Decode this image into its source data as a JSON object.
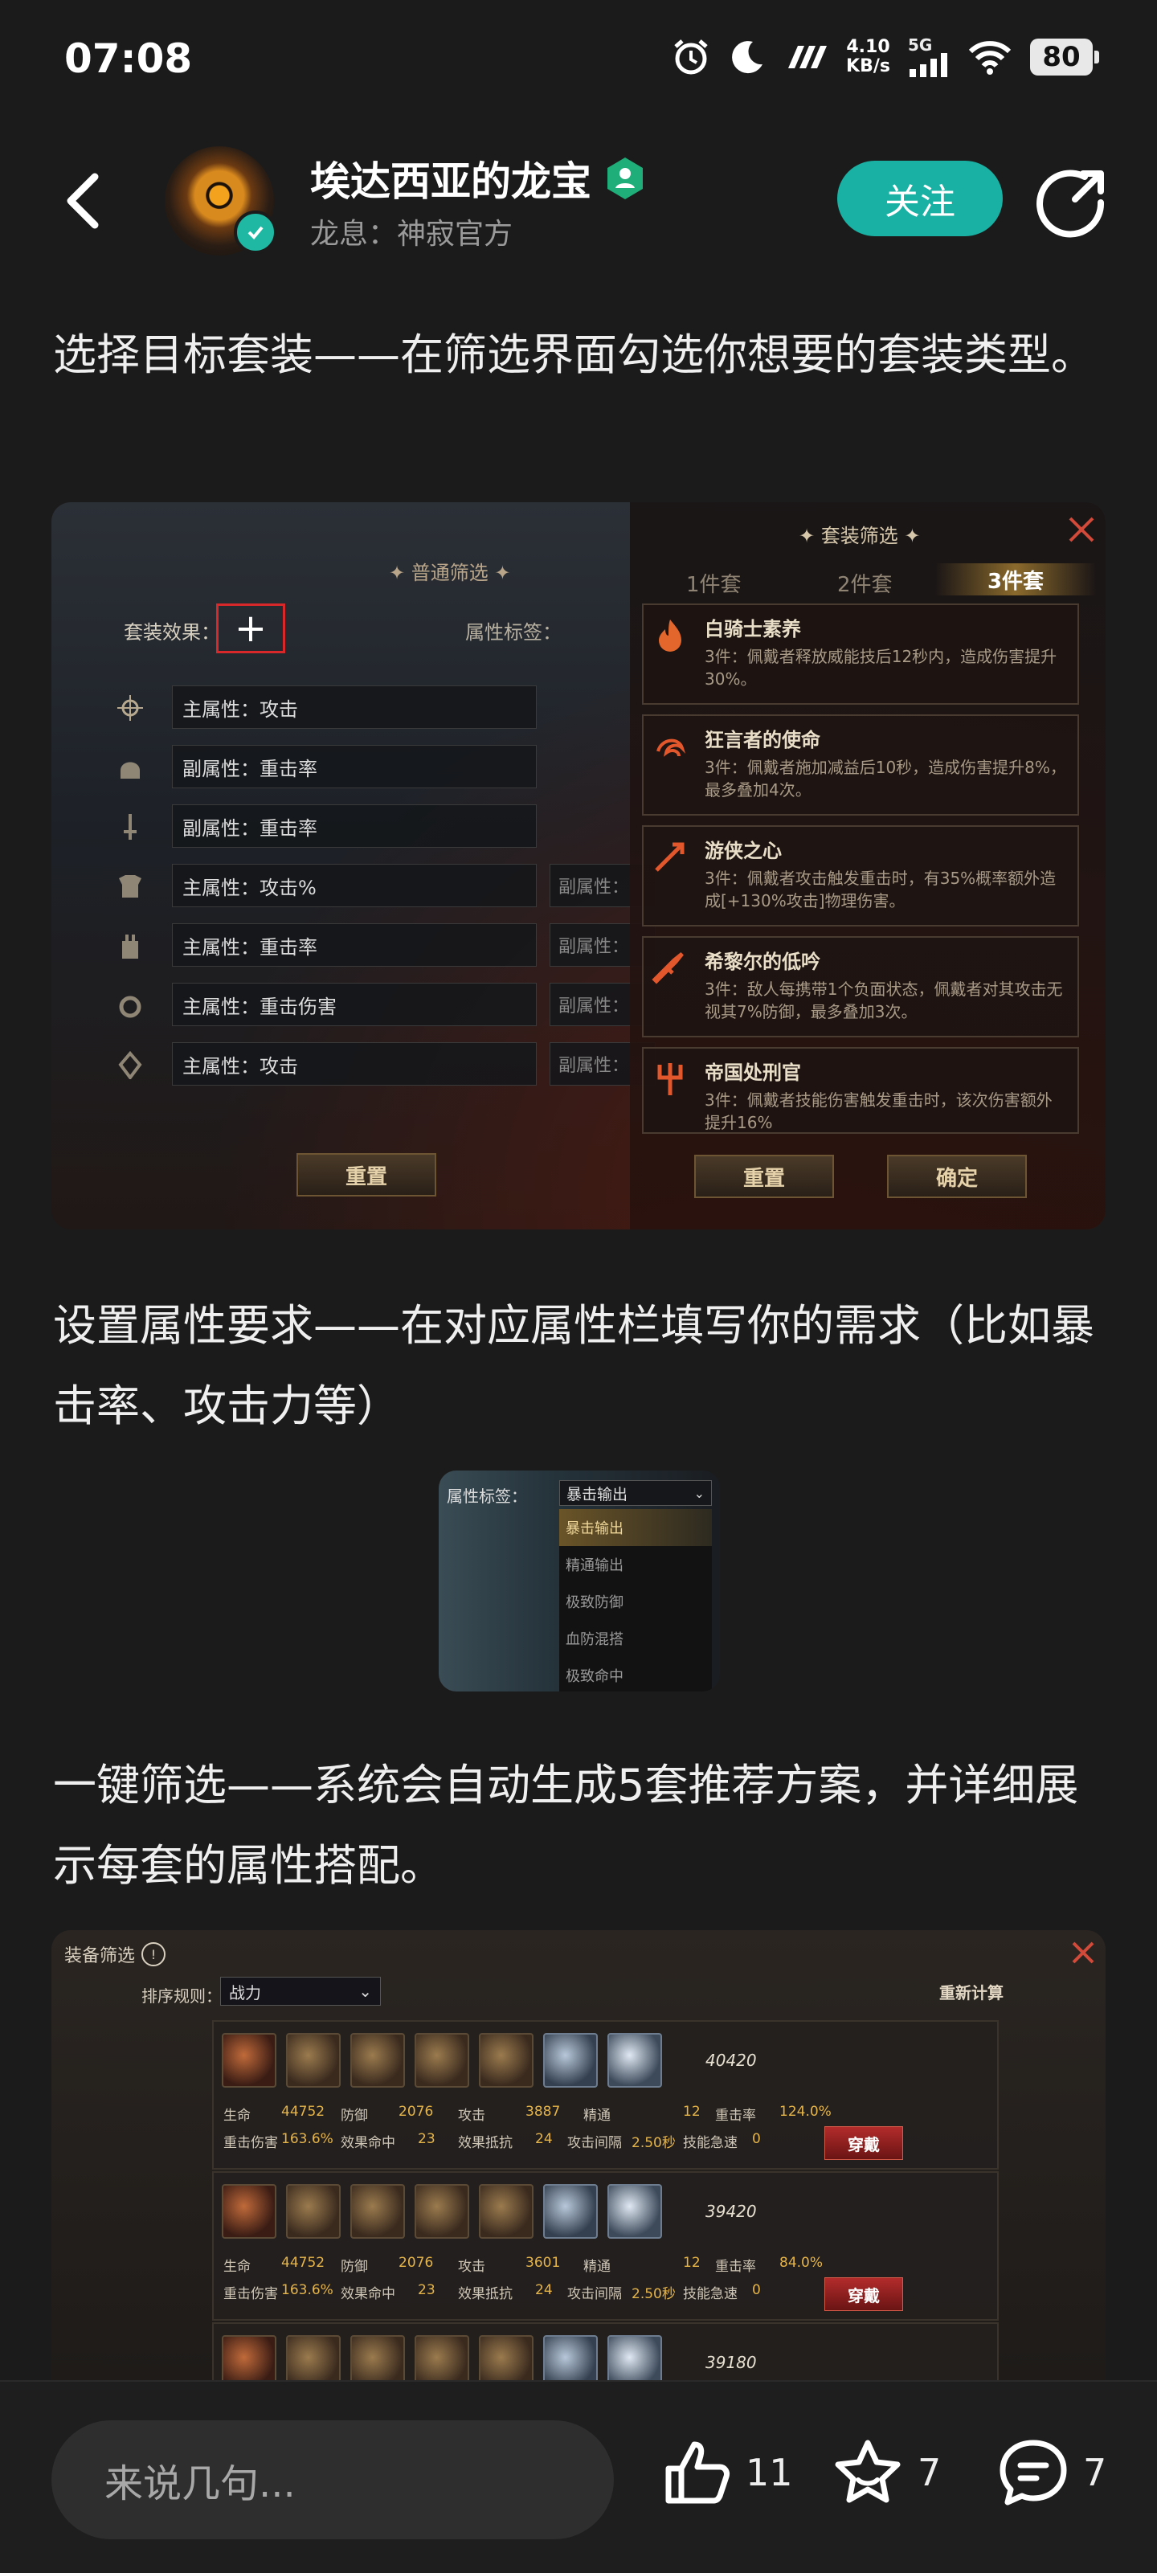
{
  "status_bar": {
    "time": "07:08",
    "net_speed_top": "4.10",
    "net_speed_bottom": "KB/s",
    "network_type": "5G",
    "battery": "80",
    "icons": [
      "alarm-icon",
      "moon-icon",
      "signal-strength-icon",
      "wifi-icon",
      "battery-icon"
    ]
  },
  "header": {
    "username": "埃达西亚的龙宝",
    "subtitle": "龙息：神寂官方",
    "follow_label": "关注"
  },
  "content": {
    "para1": "选择目标套装——在筛选界面勾选你想要的套装类型。",
    "para2": "设置属性要求——在对应属性栏填写你的需求（比如暴击率、攻击力等）",
    "para3": "一键筛选——系统会自动生成5套推荐方案，并详细展示每套的属性搭配。"
  },
  "shot1": {
    "left_title": "普通筛选",
    "set_effect_label": "套装效果：",
    "attr_tag_label": "属性标签：",
    "rows": [
      {
        "label": "主属性：攻击",
        "sub": ""
      },
      {
        "label": "副属性：重击率",
        "sub": ""
      },
      {
        "label": "副属性：重击率",
        "sub": ""
      },
      {
        "label": "主属性：攻击%",
        "sub": "副属性："
      },
      {
        "label": "主属性：重击率",
        "sub": "副属性："
      },
      {
        "label": "主属性：重击伤害",
        "sub": "副属性："
      },
      {
        "label": "主属性：攻击",
        "sub": "副属性："
      }
    ],
    "left_reset": "重置",
    "panel_title": "套装筛选",
    "tabs": [
      "1件套",
      "2件套",
      "3件套"
    ],
    "sets": [
      {
        "name": "白骑士素养",
        "desc": "3件：佩戴者释放威能技后12秒内，造成伤害提升30%。"
      },
      {
        "name": "狂言者的使命",
        "desc": "3件：佩戴者施加减益后10秒，造成伤害提升8%，最多叠加4次。"
      },
      {
        "name": "游侠之心",
        "desc": "3件：佩戴者攻击触发重击时，有35%概率额外造成[+130%攻击]物理伤害。"
      },
      {
        "name": "希黎尔的低吟",
        "desc": "3件：敌人每携带1个负面状态，佩戴者对其攻击无视其7%防御，最多叠加3次。"
      },
      {
        "name": "帝国处刑官",
        "desc": "3件：佩戴者技能伤害触发重击时，该次伤害额外提升16%"
      }
    ],
    "reset_label": "重置",
    "confirm_label": "确定"
  },
  "shot2": {
    "label": "属性标签：",
    "selected": "暴击输出",
    "options": [
      "暴击输出",
      "精通输出",
      "极致防御",
      "血防混搭",
      "极致命中"
    ]
  },
  "shot3": {
    "title": "装备筛选",
    "sort_label": "排序规则：",
    "sort_value": "战力",
    "recalc_label": "重新计算",
    "wear_label": "穿戴",
    "builds": [
      {
        "power": "40420",
        "line1": [
          [
            "生命",
            "44752"
          ],
          [
            "防御",
            "2076"
          ],
          [
            "攻击",
            "3887"
          ],
          [
            "精通",
            "12"
          ],
          [
            "重击率",
            "124.0%"
          ]
        ],
        "line2": [
          [
            "重击伤害",
            "163.6%"
          ],
          [
            "效果命中",
            "23"
          ],
          [
            "效果抵抗",
            "24"
          ],
          [
            "攻击间隔",
            "2.50秒"
          ],
          [
            "技能急速",
            "0"
          ]
        ]
      },
      {
        "power": "39420",
        "line1": [
          [
            "生命",
            "44752"
          ],
          [
            "防御",
            "2076"
          ],
          [
            "攻击",
            "3601"
          ],
          [
            "精通",
            "12"
          ],
          [
            "重击率",
            "84.0%"
          ]
        ],
        "line2": [
          [
            "重击伤害",
            "163.6%"
          ],
          [
            "效果命中",
            "23"
          ],
          [
            "效果抵抗",
            "24"
          ],
          [
            "攻击间隔",
            "2.50秒"
          ],
          [
            "技能急速",
            "0"
          ]
        ]
      },
      {
        "power": "39180",
        "line1": [],
        "line2": []
      }
    ]
  },
  "bottom_bar": {
    "comment_placeholder": "来说几句...",
    "like_count": "11",
    "favorite_count": "7",
    "comment_count": "7"
  }
}
